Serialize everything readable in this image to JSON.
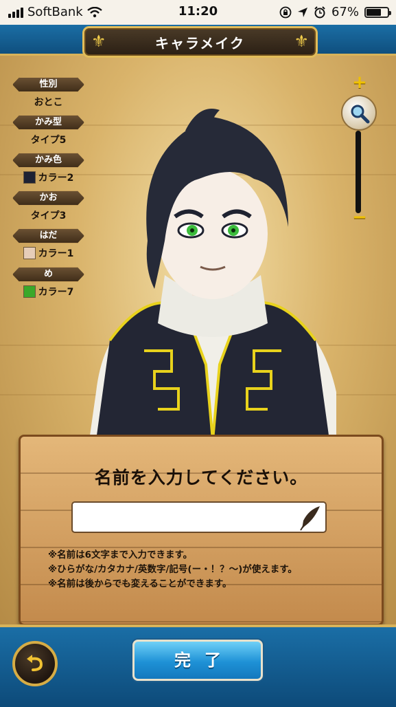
{
  "status": {
    "carrier": "SoftBank",
    "time": "11:20",
    "battery": "67%",
    "battery_level": 0.67
  },
  "header": {
    "title": "キャラメイク"
  },
  "attributes": [
    {
      "label": "性別",
      "value": "おとこ",
      "swatch": null
    },
    {
      "label": "かみ型",
      "value": "タイプ5",
      "swatch": null
    },
    {
      "label": "かみ色",
      "value": "カラー2",
      "swatch": "#1e2233"
    },
    {
      "label": "かお",
      "value": "タイプ3",
      "swatch": null
    },
    {
      "label": "はだ",
      "value": "カラー1",
      "swatch": "#e6cdb8"
    },
    {
      "label": "め",
      "value": "カラー7",
      "swatch": "#3aa82a"
    }
  ],
  "zoom": {
    "plus": "+",
    "minus": "−"
  },
  "dialog": {
    "title": "名前を入力してください。",
    "input_value": "",
    "notes": [
      "※名前は6文字まで入力できます。",
      "※ひらがな/カタカナ/英数字/記号(ー・！？〜)が使えます。",
      "※名前は後からでも変えることができます。"
    ]
  },
  "footer": {
    "done_label": "完了"
  },
  "colors": {
    "accent_blue": "#1b6ea5",
    "gold": "#d8b35a",
    "wood": "#d9a566"
  }
}
